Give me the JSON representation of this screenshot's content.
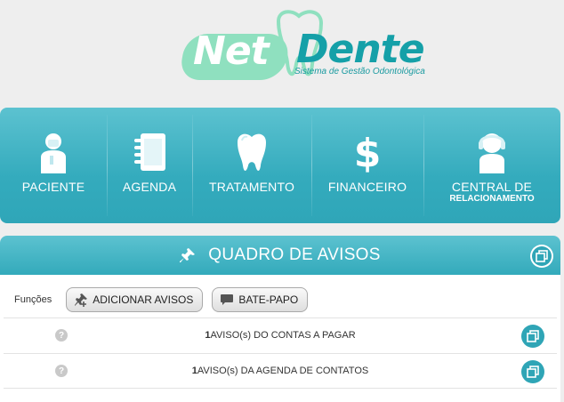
{
  "logo": {
    "part1": "Net",
    "part2": "Dente",
    "tagline": "Sistema de Gestão Odontológica"
  },
  "colors": {
    "accent": "#34abbd",
    "logo_mint": "#8fe0bf",
    "logo_teal": "#15a0a8"
  },
  "nav": {
    "items": [
      {
        "label": "PACIENTE",
        "icon": "patient-icon"
      },
      {
        "label": "AGENDA",
        "icon": "agenda-icon"
      },
      {
        "label": "TRATAMENTO",
        "icon": "tooth-icon"
      },
      {
        "label": "FINANCEIRO",
        "icon": "dollar-icon"
      },
      {
        "label": "CENTRAL DE",
        "sublabel": "RELACIONAMENTO",
        "icon": "headset-icon"
      }
    ]
  },
  "board": {
    "title": "QUADRO DE AVISOS",
    "toolbar_label": "Funções",
    "add_label": "ADICIONAR AVISOS",
    "chat_label": "BATE-PAPO",
    "rows": [
      {
        "count": "1",
        "text": "AVISO(s) DO CONTAS A PAGAR"
      },
      {
        "count": "1",
        "text": "AVISO(s) DA AGENDA DE CONTATOS"
      }
    ]
  }
}
